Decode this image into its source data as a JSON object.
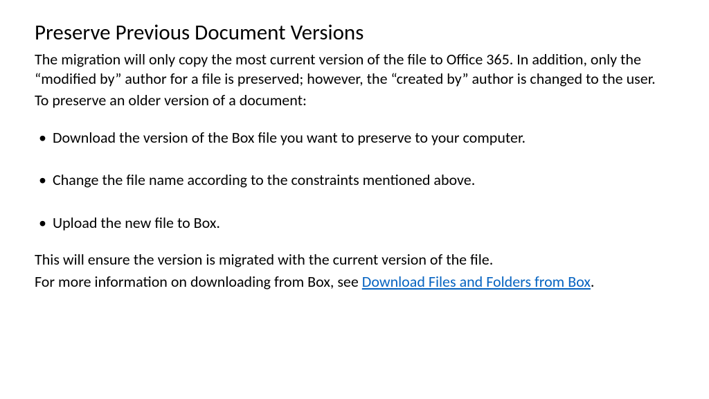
{
  "title": "Preserve Previous Document Versions",
  "intro1": "The migration will only copy the most current version of the file to Office 365. In addition, only the “modified by” author for a file is preserved; however, the “created by” author is changed to the user.",
  "intro2": "To preserve an older version of a document:",
  "steps": [
    "Download the version of the Box file you want to preserve to your computer.",
    "Change the file name according to the constraints mentioned above.",
    "Upload the new file to Box."
  ],
  "closing1": "This will ensure the version is migrated with the current version of the file.",
  "closing2_prefix": "For more information on downloading from Box, see ",
  "closing2_link": "Download Files and Folders from Box",
  "closing2_suffix": "."
}
